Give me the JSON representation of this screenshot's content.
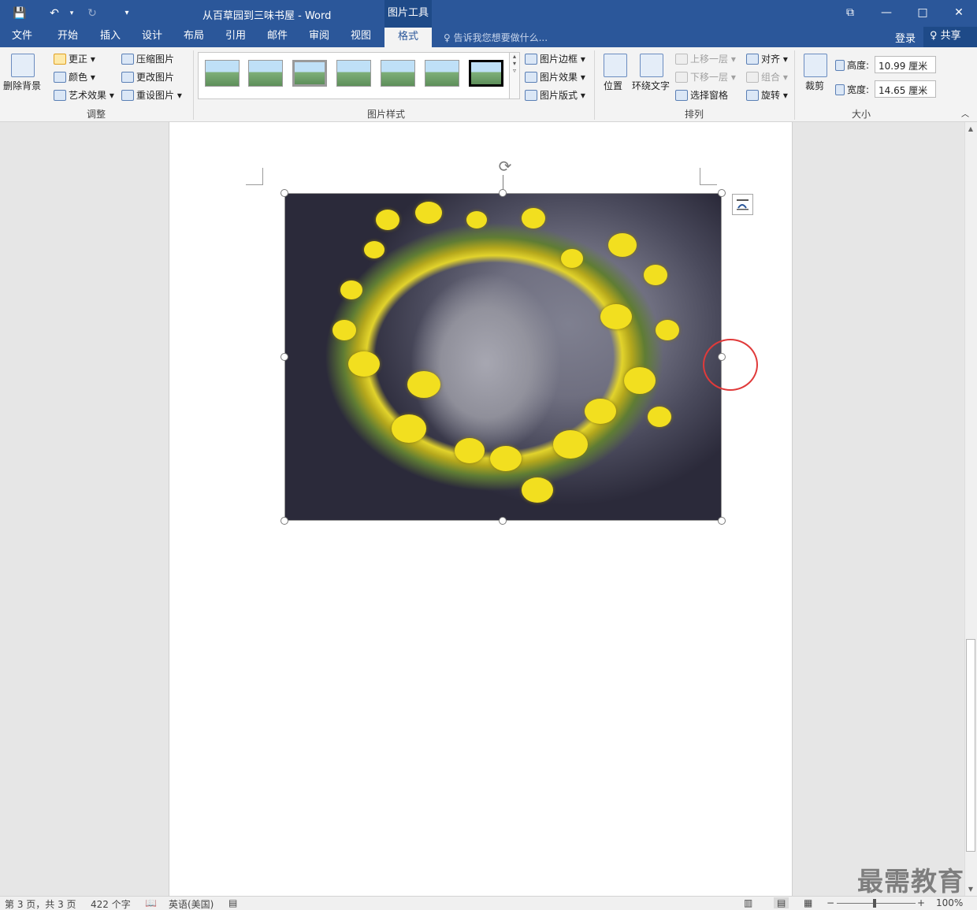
{
  "window": {
    "title": "从百草园到三味书屋 - Word",
    "context_tab_header": "图片工具",
    "save_glyph": "💾",
    "undo_glyph": "↶",
    "redo_glyph": "↻",
    "qat_more_glyph": "▾",
    "ribbon_display_glyph": "⧉",
    "minimize_glyph": "—",
    "maximize_glyph": "□",
    "close_glyph": "✕"
  },
  "tabs": [
    "文件",
    "开始",
    "插入",
    "设计",
    "布局",
    "引用",
    "邮件",
    "审阅",
    "视图",
    "格式"
  ],
  "active_tab": "格式",
  "tell_me": "♀ 告诉我您想要做什么...",
  "login": "登录",
  "share": "♀ 共享",
  "ribbon": {
    "adjust": {
      "remove_bg": "删除背景",
      "correct": "更正 ▾",
      "color": "颜色 ▾",
      "artistic": "艺术效果 ▾",
      "compress": "压缩图片",
      "change": "更改图片",
      "reset": "重设图片 ▾",
      "label": "调整"
    },
    "styles": {
      "border": "图片边框 ▾",
      "effects": "图片效果 ▾",
      "layout": "图片版式 ▾",
      "label": "图片样式"
    },
    "arrange": {
      "position": "位置",
      "wrap": "环绕文字",
      "forward": "上移一层 ▾",
      "backward": "下移一层 ▾",
      "pane": "选择窗格",
      "align": "对齐 ▾",
      "group": "组合 ▾",
      "rotate": "旋转 ▾",
      "label": "排列"
    },
    "size": {
      "crop": "裁剪",
      "height_label": "高度:",
      "height_value": "10.99 厘米",
      "width_label": "宽度:",
      "width_value": "14.65 厘米",
      "label": "大小"
    }
  },
  "status": {
    "page": "第 3 页，共 3 页",
    "words": "422 个字",
    "language": "英语(美国)",
    "zoom": "100%"
  },
  "watermark": "最需教育",
  "colors": {
    "word_blue": "#2b579a",
    "highlight_circle": "#e03a3a"
  }
}
